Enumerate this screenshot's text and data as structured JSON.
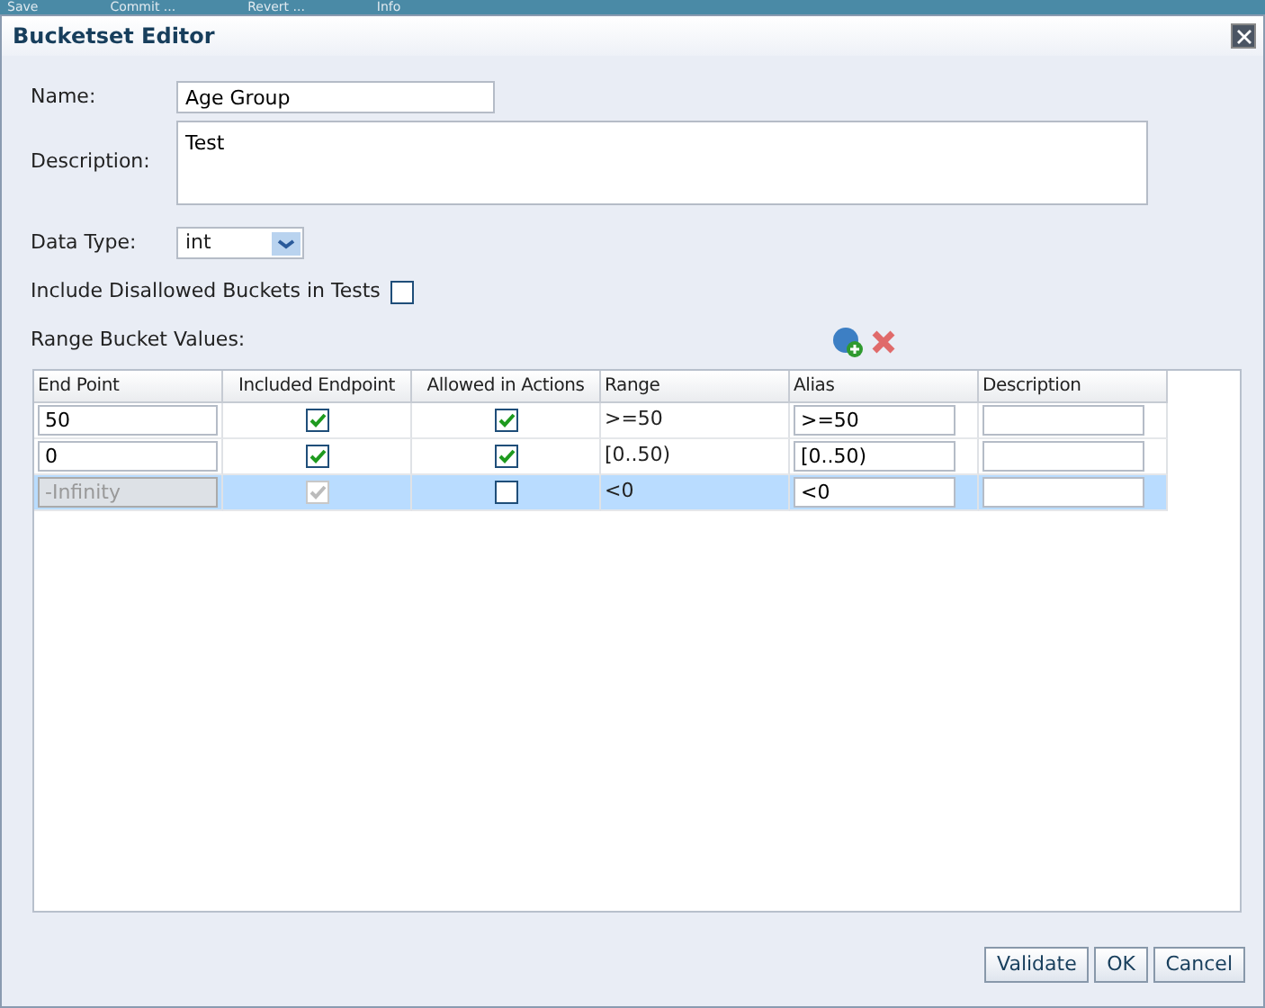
{
  "background_toolbar": [
    "Save",
    "Commit ...",
    "Revert ...",
    "Info"
  ],
  "dialog": {
    "title": "Bucketset Editor"
  },
  "form": {
    "name": {
      "label": "Name:",
      "value": "Age Group"
    },
    "description": {
      "label": "Description:",
      "value": "Test"
    },
    "data_type": {
      "label": "Data Type:",
      "value": "int"
    },
    "include_disallowed": {
      "label": "Include Disallowed Buckets in Tests",
      "checked": false
    },
    "range_label": "Range Bucket Values:"
  },
  "table": {
    "columns": [
      "End Point",
      "Included Endpoint",
      "Allowed in Actions",
      "Range",
      "Alias",
      "Description"
    ],
    "rows": [
      {
        "end_point": "50",
        "end_point_disabled": false,
        "included": true,
        "included_disabled": false,
        "allowed": true,
        "range": ">=50",
        "alias": ">=50",
        "selected": false
      },
      {
        "end_point": "0",
        "end_point_disabled": false,
        "included": true,
        "included_disabled": false,
        "allowed": true,
        "range": "[0..50)",
        "alias": "[0..50)",
        "selected": false
      },
      {
        "end_point": "-Infinity",
        "end_point_disabled": true,
        "included": true,
        "included_disabled": true,
        "allowed": false,
        "range": "<0",
        "alias": "<0",
        "selected": true
      }
    ]
  },
  "buttons": [
    "Validate",
    "OK",
    "Cancel"
  ]
}
